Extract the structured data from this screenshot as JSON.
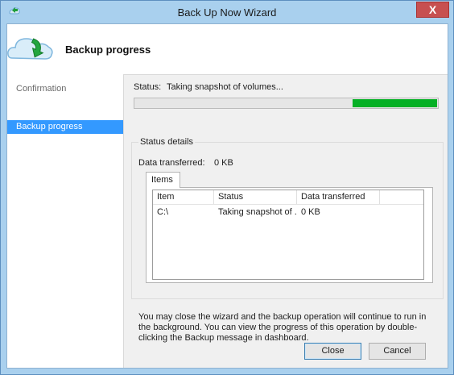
{
  "window": {
    "title": "Back Up Now Wizard",
    "close_glyph": "X"
  },
  "header": {
    "title": "Backup progress",
    "icon": "cloud-backup-icon"
  },
  "nav": {
    "items": [
      {
        "label": "Confirmation",
        "active": false
      },
      {
        "label": "Backup progress",
        "active": true
      }
    ]
  },
  "status": {
    "label": "Status:",
    "value": "Taking snapshot of volumes...",
    "progress_fill_start": 0.72,
    "progress_fill_end": 1.0
  },
  "details": {
    "legend": "Status details",
    "data_transferred_label": "Data transferred:",
    "data_transferred_value": "0 KB",
    "tab_label": "Items",
    "columns": [
      "Item",
      "Status",
      "Data transferred"
    ],
    "rows": [
      [
        "C:\\",
        "Taking snapshot of ...",
        "0 KB"
      ]
    ]
  },
  "note": "You may close the wizard and the backup operation will continue to run in the background. You can view the progress of this operation by double-clicking the Backup message in dashboard.",
  "buttons": {
    "close": "Close",
    "cancel": "Cancel"
  },
  "colors": {
    "titlebar": "#a9d0ee",
    "selected": "#3399ff",
    "progress": "#06b025",
    "close_button": "#c75050"
  }
}
